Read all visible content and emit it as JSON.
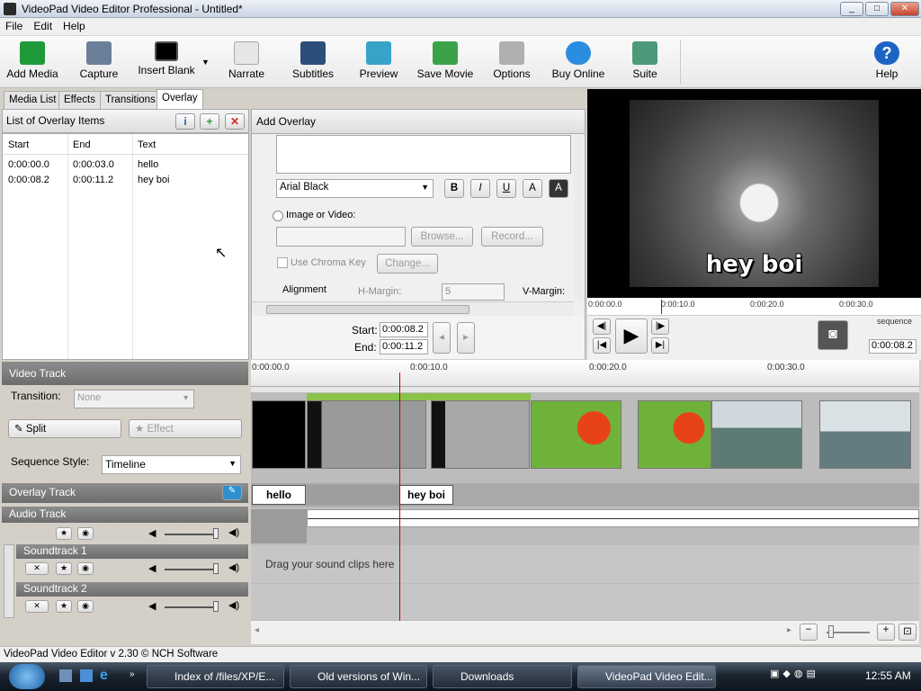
{
  "window": {
    "title": "VideoPad Video Editor Professional - Untitled*",
    "buttons": [
      "_",
      "□",
      "✕"
    ]
  },
  "menu": [
    "File",
    "Edit",
    "Help"
  ],
  "toolbar": [
    {
      "label": "Add Media",
      "icon": "add-media-icon",
      "color": "#1f9a3a"
    },
    {
      "label": "Capture",
      "icon": "capture-icon",
      "color": "#6b7f99"
    },
    {
      "label": "Insert Blank",
      "icon": "insert-blank-icon",
      "color": "#000000"
    },
    {
      "label": "Narrate",
      "icon": "narrate-icon",
      "color": "#c9c9c9"
    },
    {
      "label": "Subtitles",
      "icon": "subtitles-icon",
      "color": "#2c4f7a"
    },
    {
      "label": "Preview",
      "icon": "preview-icon",
      "color": "#38a3c9"
    },
    {
      "label": "Save Movie",
      "icon": "save-movie-icon",
      "color": "#3aa34a"
    },
    {
      "label": "Options",
      "icon": "options-icon",
      "color": "#b0b0b0"
    },
    {
      "label": "Buy Online",
      "icon": "buy-online-icon",
      "color": "#2b8de0"
    },
    {
      "label": "Suite",
      "icon": "suite-icon",
      "color": "#4c9a7a"
    },
    {
      "label": "Help",
      "icon": "help-icon",
      "color": "#1c64c4"
    }
  ],
  "tabs": [
    "Media List",
    "Effects",
    "Transitions",
    "Overlay"
  ],
  "overlay_list": {
    "title": "List of Overlay Items",
    "columns": [
      "Start",
      "End",
      "Text"
    ],
    "rows": [
      {
        "start": "0:00:00.0",
        "end": "0:00:03.0",
        "text": "hello"
      },
      {
        "start": "0:00:08.2",
        "end": "0:00:11.2",
        "text": "hey boi"
      }
    ]
  },
  "add_overlay": {
    "title": "Add Overlay",
    "font": "Arial Black",
    "format_buttons": [
      "B",
      "I",
      "U",
      "A",
      "A"
    ],
    "image_option": "Image or Video:",
    "browse": "Browse...",
    "record": "Record...",
    "chroma": "Use Chroma Key",
    "change": "Change...",
    "alignment": "Alignment",
    "hmargin": "H-Margin:",
    "hmargin_value": "5",
    "vmargin": "V-Margin:",
    "start_label": "Start:",
    "start_value": "0:00:08.2",
    "end_label": "End:",
    "end_value": "0:00:11.2"
  },
  "preview": {
    "overlay_text": "hey boi",
    "ruler": [
      "0:00:00.0",
      "0:00:10.0",
      "0:00:20.0",
      "0:00:30.0"
    ],
    "mode": "sequence",
    "time": "0:00:08.2"
  },
  "left_tracks": {
    "video_track": "Video Track",
    "transition_label": "Transition:",
    "transition_value": "None",
    "split": "Split",
    "effect": "Effect",
    "sequence_style_label": "Sequence Style:",
    "sequence_style_value": "Timeline",
    "overlay_track": "Overlay Track",
    "audio_track": "Audio Track",
    "soundtrack1": "Soundtrack 1",
    "soundtrack2": "Soundtrack 2"
  },
  "timeline": {
    "ruler": [
      "0:00:00.0",
      "0:00:10.0",
      "0:00:20.0",
      "0:00:30.0"
    ],
    "overlay_clips": [
      "hello",
      "hey boi"
    ],
    "drag_hint": "Drag your sound clips here"
  },
  "status": "VideoPad Video Editor v 2.30 © NCH Software",
  "taskbar": {
    "items": [
      "Index of /files/XP/E...",
      "Old versions of Win...",
      "Downloads",
      "VideoPad Video Edit..."
    ],
    "clock": "12:55 AM"
  }
}
